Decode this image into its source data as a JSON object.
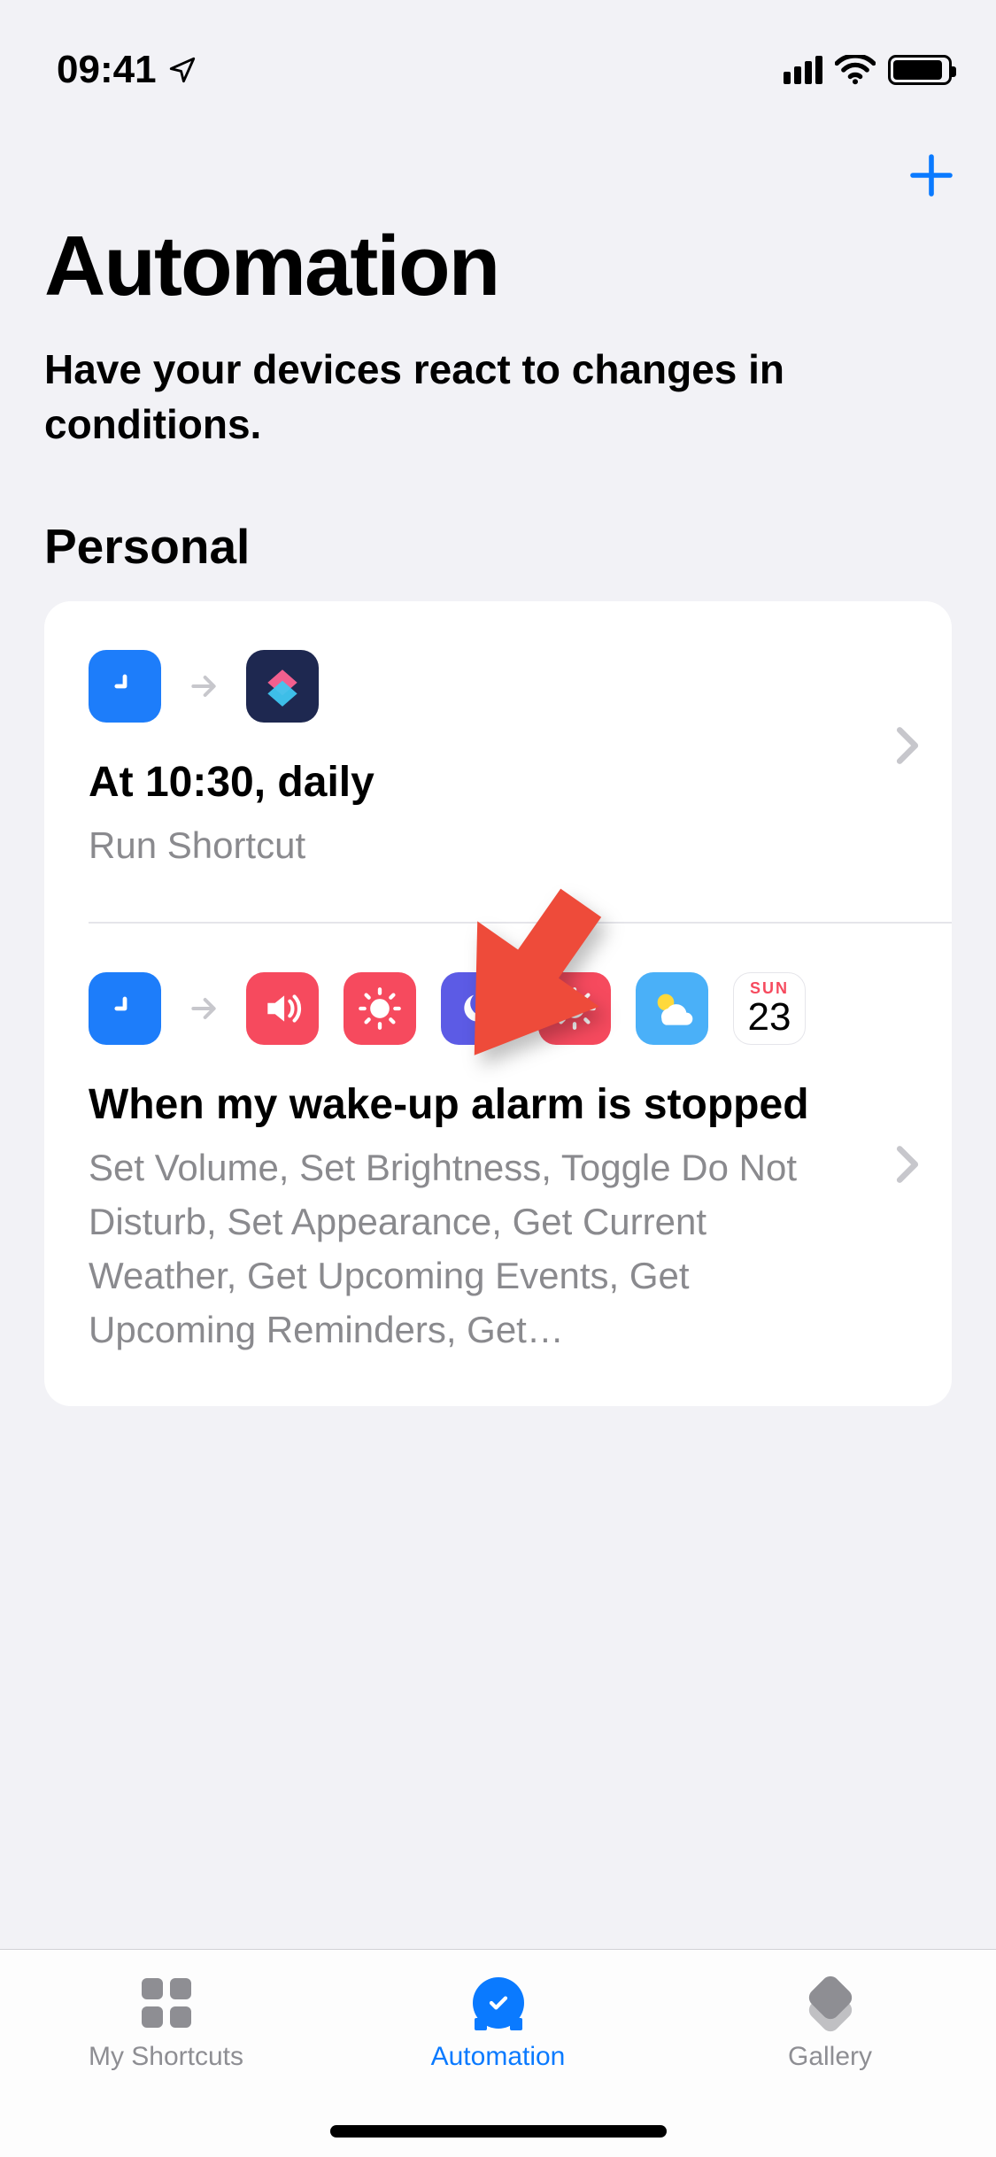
{
  "status": {
    "time": "09:41"
  },
  "nav": {
    "add_label": "+"
  },
  "header": {
    "title": "Automation",
    "subtitle": "Have your devices react to changes in conditions."
  },
  "sections": {
    "personal_heading": "Personal"
  },
  "automations": [
    {
      "title": "At 10:30, daily",
      "subtitle": "Run Shortcut"
    },
    {
      "title": "When my wake-up alarm is stopped",
      "subtitle": "Set Volume, Set Brightness, Toggle Do Not Disturb, Set Appearance, Get Current Weather, Get Upcoming Events, Get Upcoming Reminders, Get…"
    }
  ],
  "calendar_tile": {
    "weekday": "SUN",
    "day": "23"
  },
  "tabs": {
    "my_shortcuts": "My Shortcuts",
    "automation": "Automation",
    "gallery": "Gallery"
  }
}
